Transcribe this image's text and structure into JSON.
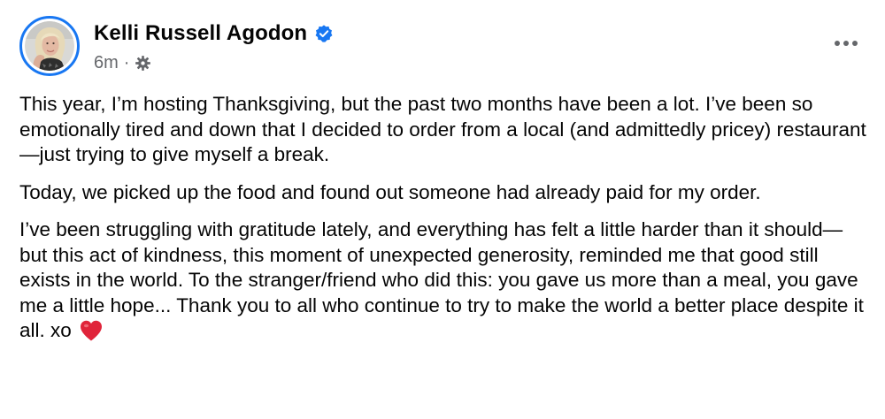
{
  "post": {
    "author": "Kelli Russell Agodon",
    "verified_icon": "verified-badge-icon",
    "timestamp": "6m",
    "separator": "·",
    "privacy_icon": "gear-icon",
    "more_icon": "more-options-icon",
    "paragraphs": [
      "This year, I’m hosting Thanksgiving, but the past two months have been a lot. I’ve been so emotionally tired and down that I decided to order from a local (and admittedly pricey) restaurant—just trying to give myself a break.",
      "Today, we picked up the food and found out someone had already paid for my order.",
      "I’ve been struggling with gratitude lately, and everything has felt a little harder than it should—but this act of kindness, this moment of unexpected generosity, reminded me that good still exists in the world. To the stranger/friend who did this: you gave us more than a meal, you gave me a little hope... Thank you to all who continue to try to make the world a better place despite it all. xo"
    ],
    "emoji_icon": "red-heart-icon"
  },
  "colors": {
    "accent": "#1877f2",
    "text": "#050505",
    "secondary_text": "#65676b",
    "heart": "#e0243a"
  }
}
